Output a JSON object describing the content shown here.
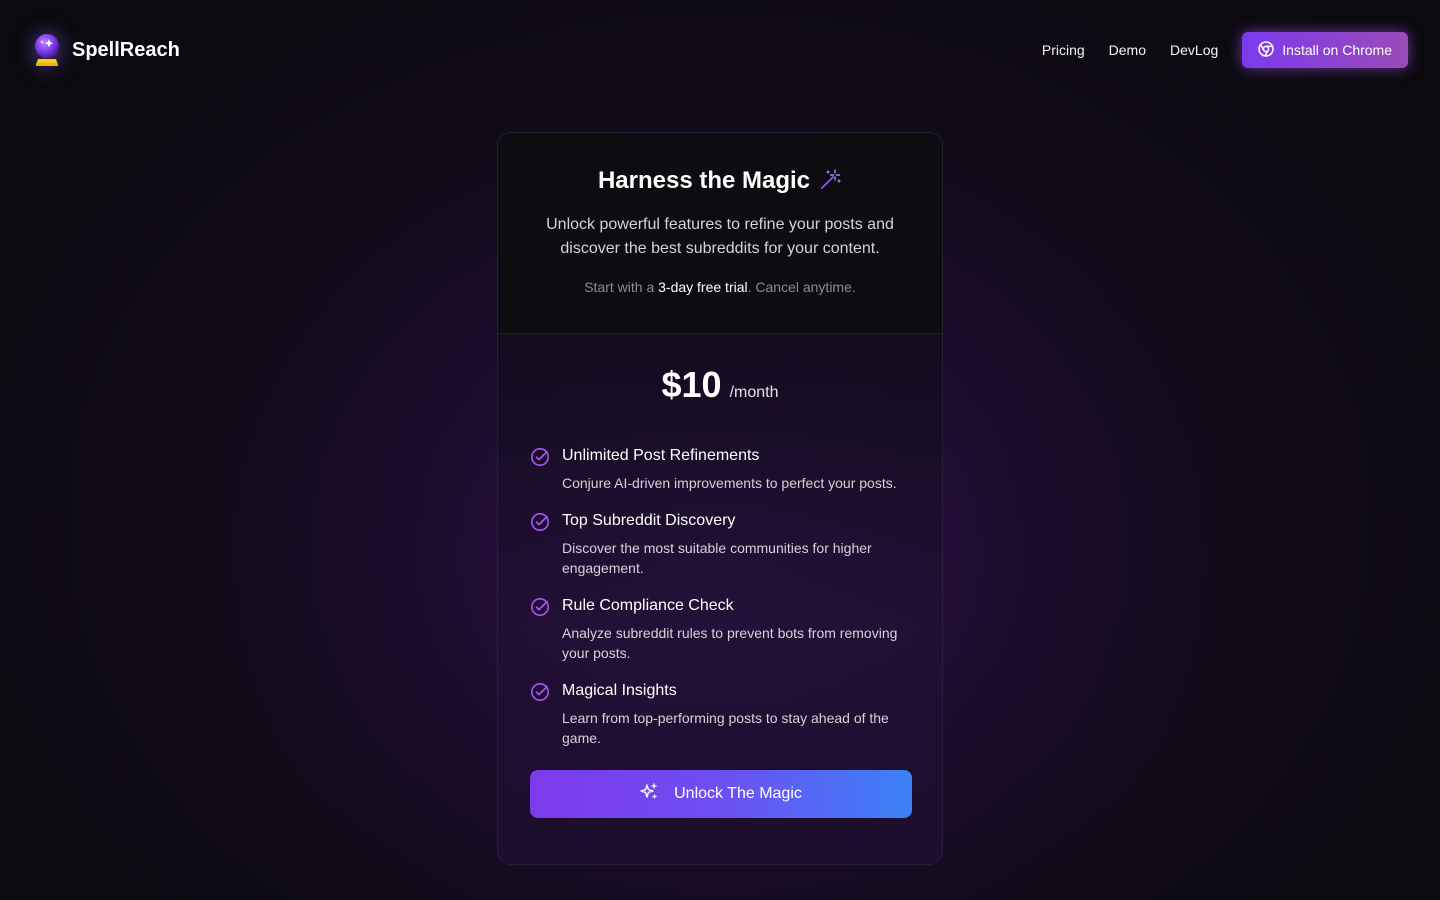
{
  "header": {
    "brand_name": "SpellReach",
    "nav": {
      "pricing": "Pricing",
      "demo": "Demo",
      "devlog": "DevLog"
    },
    "install_label": "Install on Chrome"
  },
  "card": {
    "title": "Harness the Magic",
    "subtitle": "Unlock powerful features to refine your posts and discover the best subreddits for your content.",
    "trial_prefix": "Start with a ",
    "trial_highlight": "3-day free trial",
    "trial_suffix": ". Cancel anytime.",
    "price": "$10",
    "period": "/month",
    "features": [
      {
        "title": "Unlimited Post Refinements",
        "desc": "Conjure AI-driven improvements to perfect your posts."
      },
      {
        "title": "Top Subreddit Discovery",
        "desc": "Discover the most suitable communities for higher engagement."
      },
      {
        "title": "Rule Compliance Check",
        "desc": "Analyze subreddit rules to prevent bots from removing your posts."
      },
      {
        "title": "Magical Insights",
        "desc": "Learn from top-performing posts to stay ahead of the game."
      }
    ],
    "cta_label": "Unlock The Magic"
  },
  "colors": {
    "accent": "#7c3aed",
    "accent_blue": "#3b82f6",
    "check": "#a855f7"
  },
  "icons": {
    "logo": "crystal-ball-icon",
    "install": "chrome-icon",
    "title": "magic-wand-icon",
    "feature": "check-circle-icon",
    "cta": "sparkles-icon"
  }
}
